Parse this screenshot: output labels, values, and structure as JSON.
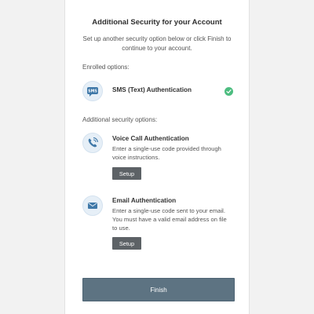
{
  "header": {
    "title": "Additional Security for your Account",
    "subtitle": "Set up another security option below or click Finish to continue to your account."
  },
  "enrolled": {
    "label": "Enrolled options:",
    "options": [
      {
        "title": "SMS (Text) Authentication",
        "icon": "sms-icon",
        "status": "enrolled-check-icon"
      }
    ]
  },
  "additional": {
    "label": "Additional security options:",
    "options": [
      {
        "title": "Voice Call Authentication",
        "description": "Enter a single-use code provided through voice instructions.",
        "button": "Setup",
        "icon": "phone-icon"
      },
      {
        "title": "Email Authentication",
        "description": "Enter a single-use code sent to your email. You must have a valid email address on file to use.",
        "button": "Setup",
        "icon": "envelope-icon"
      }
    ]
  },
  "footer": {
    "finish_label": "Finish"
  },
  "colors": {
    "icon_bg": "#e6eff7",
    "icon_accent": "#3f78a8",
    "check": "#4dbd80",
    "setup_button": "#5d6266",
    "finish_button": "#5d7382"
  }
}
